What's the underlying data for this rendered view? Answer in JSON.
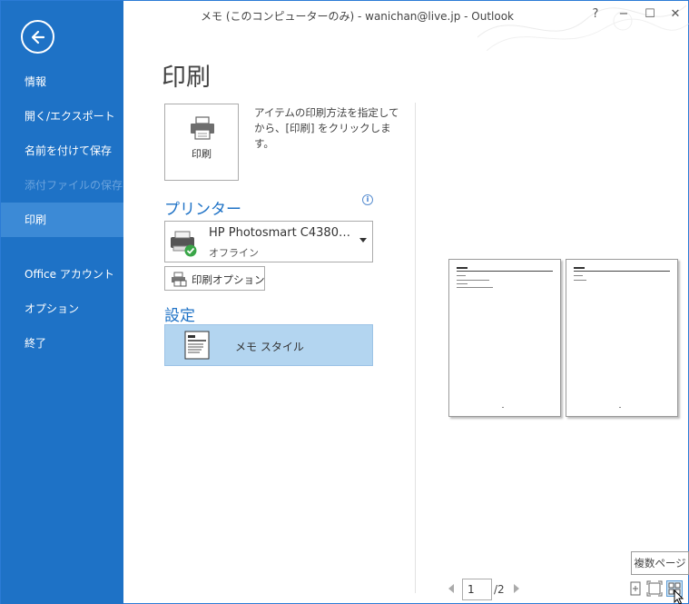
{
  "window": {
    "title": "メモ (このコンピューターのみ) - wanichan@live.jp - Outlook",
    "help": "?",
    "minimize": "−",
    "restore": "☐",
    "close": "✕"
  },
  "sidebar": {
    "items": [
      {
        "label": "情報"
      },
      {
        "label": "開く/エクスポート"
      },
      {
        "label": "名前を付けて保存"
      },
      {
        "label": "添付ファイルの保存"
      },
      {
        "label": "印刷"
      },
      {
        "label": "Office アカウント"
      },
      {
        "label": "オプション"
      },
      {
        "label": "終了"
      }
    ]
  },
  "main": {
    "title": "印刷",
    "print_button_label": "印刷",
    "print_description": "アイテムの印刷方法を指定してから、[印刷] をクリックします。",
    "printer_heading": "プリンター",
    "printer_name": "HP Photosmart C4380…",
    "printer_status": "オフライン",
    "print_options_label": "印刷オプション",
    "settings_heading": "設定",
    "style_label": "メモ スタイル"
  },
  "preview": {
    "current_page": "1",
    "total_pages": "/2",
    "tooltip": "複数ページ"
  },
  "colors": {
    "accent": "#1e72c6",
    "selected_style_bg": "#b3d5f0"
  }
}
